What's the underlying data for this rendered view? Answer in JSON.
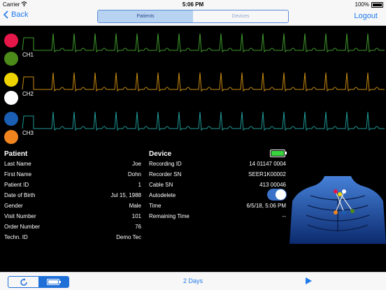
{
  "status_bar": {
    "carrier": "Carrier",
    "time": "5:06 PM",
    "battery_percent": "100%"
  },
  "nav": {
    "back_label": "Back",
    "tabs": [
      "Patients",
      "Devices"
    ],
    "active_tab": 0,
    "logout_label": "Logout"
  },
  "channels": [
    {
      "label": "CH1",
      "colors": [
        "#e8174a",
        "#4c8a1a"
      ],
      "trace_color": "#3f9a2a"
    },
    {
      "label": "CH2",
      "colors": [
        "#f0d400",
        "#ffffff"
      ],
      "trace_color": "#c88a10"
    },
    {
      "label": "CH3",
      "colors": [
        "#1a5fb4",
        "#f0851f"
      ],
      "trace_color": "#1f9a96"
    }
  ],
  "patient": {
    "heading": "Patient",
    "rows": [
      {
        "label": "Last Name",
        "value": "Joe"
      },
      {
        "label": "First Name",
        "value": "Dohn"
      },
      {
        "label": "Patient ID",
        "value": "1"
      },
      {
        "label": "Date of Birth",
        "value": "Jul 15, 1988"
      },
      {
        "label": "Gender",
        "value": "Male"
      },
      {
        "label": "Visit Number",
        "value": "101"
      },
      {
        "label": "Order Number",
        "value": "76"
      },
      {
        "label": "Techn. ID",
        "value": "Demo Tec"
      }
    ]
  },
  "device": {
    "heading": "Device",
    "battery_level": 1.0,
    "rows": [
      {
        "label": "Recording ID",
        "value": "14 01147 0004"
      },
      {
        "label": "Recorder SN",
        "value": "SEER1K00002"
      },
      {
        "label": "Cable SN",
        "value": "413 00046"
      },
      {
        "label": "Autodelete",
        "value": ""
      },
      {
        "label": "Time",
        "value": "6/5/18, 5:06 PM"
      },
      {
        "label": "Remaining Time",
        "value": "--"
      }
    ],
    "autodelete_on": true
  },
  "footer": {
    "duration": "2 Days"
  },
  "colors": {
    "accent": "#1f7aec",
    "background": "#000000",
    "bar": "#f7f7f7"
  },
  "icons": [
    "chevron-left-icon",
    "refresh-icon",
    "battery-icon",
    "play-icon",
    "torso-electrodes-image"
  ]
}
